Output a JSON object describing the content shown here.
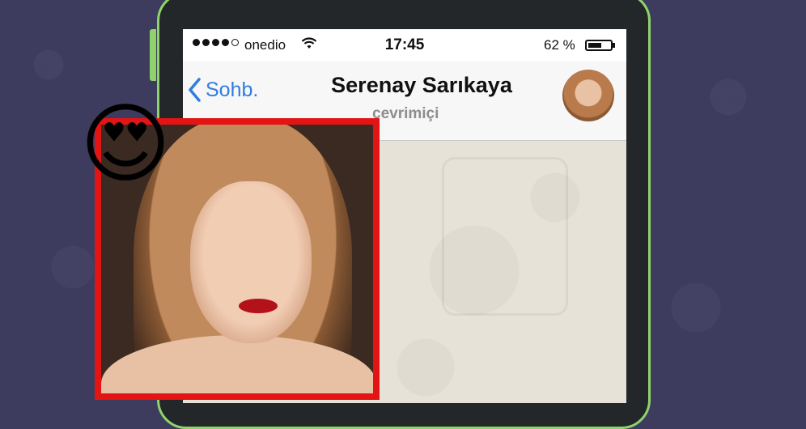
{
  "status_bar": {
    "carrier": "onedio",
    "time": "17:45",
    "battery_percent": "62 %",
    "battery_level": 0.62,
    "signal_bars": 4
  },
  "nav": {
    "back_label": "Sohb.",
    "contact_name": "Serenay Sarıkaya",
    "contact_status": "çevrimiçi"
  },
  "overlay": {
    "emoji": "😍"
  },
  "icons": [
    "signal-icon",
    "wifi-icon",
    "battery-icon",
    "chevron-left-icon",
    "avatar"
  ],
  "colors": {
    "accent": "#2f7de1",
    "frame": "#e31414",
    "phone_border": "#8fd46a",
    "background": "#3d3b5e"
  }
}
